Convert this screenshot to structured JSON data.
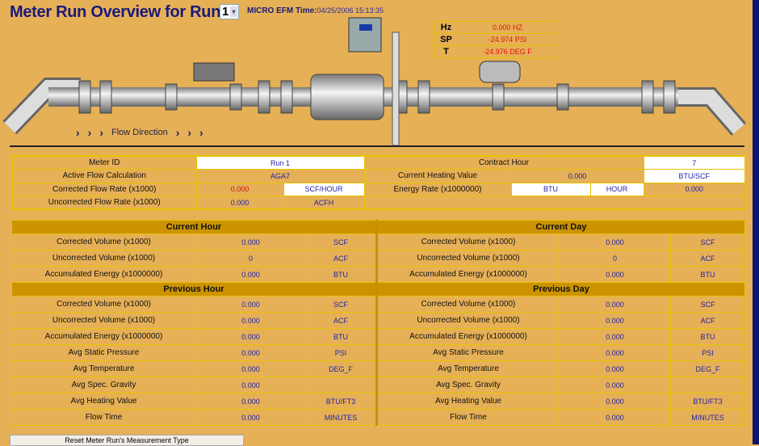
{
  "title": "Meter Run Overview for Run #",
  "run_select": "1",
  "time_label": "MICRO EFM Time:",
  "time_value": "04/25/2006 15:13:35",
  "process": [
    {
      "label": "Hz",
      "value": "0.000   HZ"
    },
    {
      "label": "SP",
      "value": "-24.974   PSI"
    },
    {
      "label": "T",
      "value": "-24.976   DEG F"
    }
  ],
  "flow_direction": "Flow Direction",
  "info": {
    "meter_id_label": "Meter ID",
    "meter_id": "Run 1",
    "contract_hour_label": "Contract Hour",
    "contract_hour": "7",
    "active_calc_label": "Active Flow Calculation",
    "active_calc": "AGA7",
    "heating_label": "Current Heating Value",
    "heating_value": "0.000",
    "heating_unit": "BTU/SCF",
    "corr_rate_label": "Corrected Flow Rate (x1000)",
    "corr_rate": "0.000",
    "corr_rate_unit": "SCF/HOUR",
    "energy_rate_label": "Energy Rate (x1000000)",
    "energy_unit1": "BTU",
    "energy_unit2": "HOUR",
    "energy_rate": "0.000",
    "uncorr_rate_label": "Uncorrected Flow Rate (x1000)",
    "uncorr_rate": "0.000",
    "uncorr_rate_unit": "ACFH"
  },
  "sections": {
    "current_hour": "Current Hour",
    "current_day": "Current Day",
    "previous_hour": "Previous Hour",
    "previous_day": "Previous Day"
  },
  "current_rows": [
    {
      "label": "Corrected Volume (x1000)",
      "h": "0.000",
      "hu": "SCF",
      "d": "0.000",
      "du": "SCF"
    },
    {
      "label": "Uncorrected Volume (x1000)",
      "h": "0",
      "hu": "ACF",
      "d": "0",
      "du": "ACF"
    },
    {
      "label": "Accumulated Energy (x1000000)",
      "h": "0.000",
      "hu": "BTU",
      "d": "0.000",
      "du": "BTU"
    }
  ],
  "previous_rows": [
    {
      "label": "Corrected Volume (x1000)",
      "h": "0.000",
      "hu": "SCF",
      "d": "0.000",
      "du": "SCF"
    },
    {
      "label": "Uncorrected Volume (x1000)",
      "h": "0.000",
      "hu": "ACF",
      "d": "0.000",
      "du": "ACF"
    },
    {
      "label": "Accumulated Energy (x1000000)",
      "h": "0.000",
      "hu": "BTU",
      "d": "0.000",
      "du": "BTU"
    },
    {
      "label": "Avg Static Pressure",
      "h": "0.000",
      "hu": "PSI",
      "d": "0.000",
      "du": "PSI"
    },
    {
      "label": "Avg Temperature",
      "h": "0.000",
      "hu": "DEG_F",
      "d": "0.000",
      "du": "DEG_F"
    },
    {
      "label": "Avg Spec. Gravity",
      "h": "0.000",
      "hu": "",
      "d": "0.000",
      "du": ""
    },
    {
      "label": "Avg Heating Value",
      "h": "0.000",
      "hu": "BTU/FT3",
      "d": "0.000",
      "du": "BTU/FT3"
    },
    {
      "label": "Flow Time",
      "h": "0.000",
      "hu": "MINUTES",
      "d": "0.000",
      "du": "MINUTES"
    }
  ],
  "reset_button": "Reset Meter Run's Measurement Type"
}
